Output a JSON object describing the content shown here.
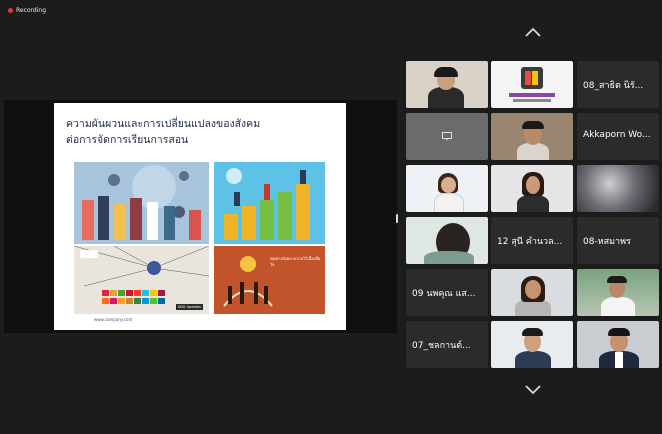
{
  "recording": {
    "label": "Recording"
  },
  "slide": {
    "title_line1": "ความผันผวนและการเปลี่ยนแปลงของสังคม",
    "title_line2": "ต่อการจัดการเรียนการสอน",
    "url": "www.company.com",
    "badge": "SDG Updates",
    "panel4_text": "ทุนทางสังคม ความไว้เนื้อเชื่อใจ"
  },
  "gallery": {
    "up_icon": "chevron-up-icon",
    "down_icon": "chevron-down-icon",
    "names": {
      "n1": "08_สาธิต นิรั...",
      "n2": "Akkaporn Wo...",
      "n3": "12 สุนี คำนวล...",
      "n4": "08-หสมาพร",
      "n5": "09 นพคุณ แส...",
      "n6": "07_ชลกานต์..."
    }
  },
  "colors": {
    "active_speaker": "#2ecc71",
    "record": "#e53935"
  }
}
